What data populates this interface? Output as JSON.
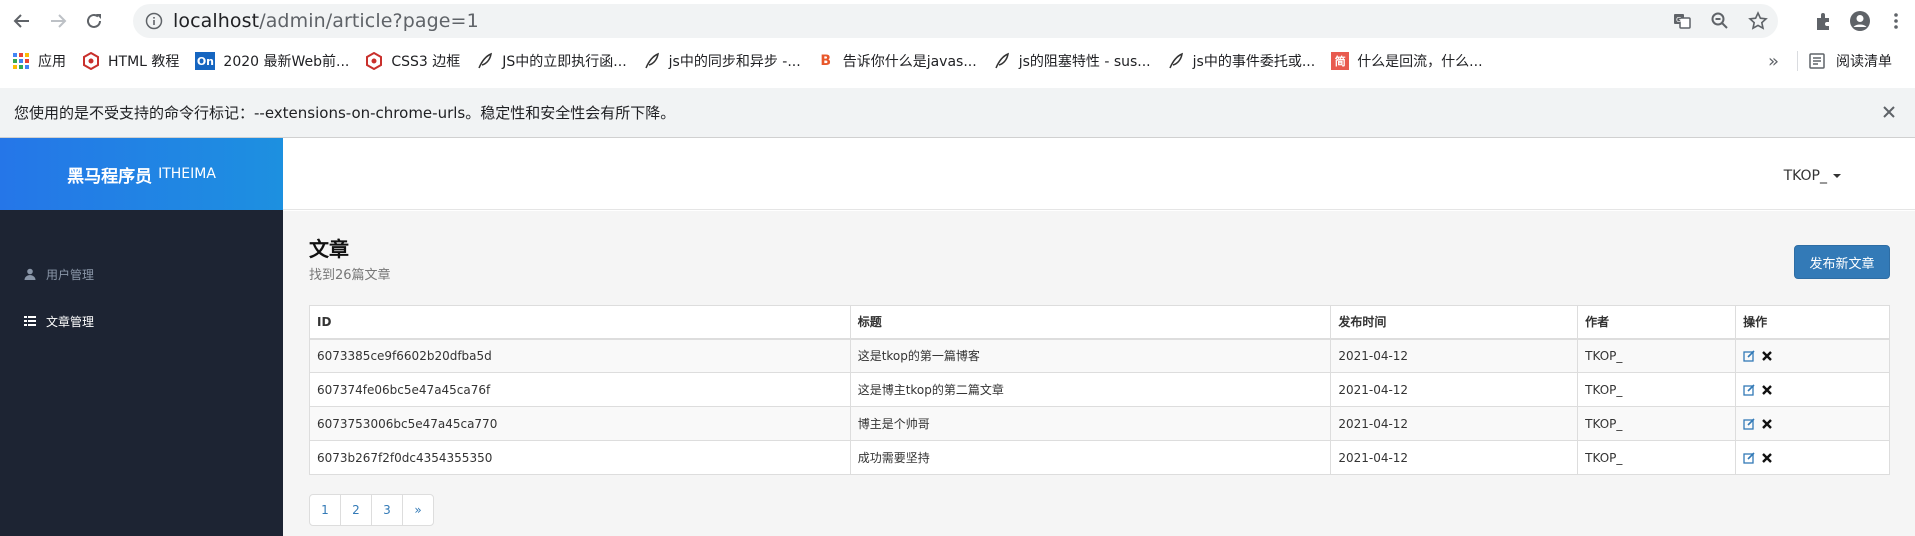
{
  "browser": {
    "url_host": "localhost",
    "url_path": "/admin/article?page=1",
    "bookmarks": [
      {
        "label": "应用",
        "icon": "apps-grid-icon"
      },
      {
        "label": "HTML 教程",
        "icon": "runoob-icon"
      },
      {
        "label": "2020 最新Web前...",
        "icon": "on-badge-icon"
      },
      {
        "label": "CSS3 边框",
        "icon": "runoob-icon"
      },
      {
        "label": "JS中的立即执行函...",
        "icon": "feather-icon"
      },
      {
        "label": "js中的同步和异步 -...",
        "icon": "feather-icon"
      },
      {
        "label": "告诉你什么是javas...",
        "icon": "b-logo-icon"
      },
      {
        "label": "js的阻塞特性 - sus...",
        "icon": "feather-icon"
      },
      {
        "label": "js中的事件委托或...",
        "icon": "feather-icon"
      },
      {
        "label": "什么是回流，什么...",
        "icon": "jian-icon"
      }
    ],
    "bookmarks_more": "»",
    "reading_list": "阅读清单",
    "infobar_message": "您使用的是不受支持的命令行标记：--extensions-on-chrome-urls。稳定性和安全性会有所下降。"
  },
  "app": {
    "brand": {
      "name": "黑马程序员",
      "sub": "ITHEIMA"
    },
    "user": "TKOP_",
    "menu": [
      {
        "label": "用户管理",
        "icon": "user-icon",
        "active": false
      },
      {
        "label": "文章管理",
        "icon": "list-icon",
        "active": true
      }
    ],
    "page_title": "文章",
    "page_subtitle": "找到26篇文章",
    "publish_button": "发布新文章",
    "table": {
      "headers": [
        "ID",
        "标题",
        "发布时间",
        "作者",
        "操作"
      ],
      "rows": [
        [
          "6073385ce9f6602b20dfba5d",
          "这是tkop的第一篇博客",
          "2021-04-12",
          "TKOP_"
        ],
        [
          "607374fe06bc5e47a45ca76f",
          "这是博主tkop的第二篇文章",
          "2021-04-12",
          "TKOP_"
        ],
        [
          "6073753006bc5e47a45ca770",
          "博主是个帅哥",
          "2021-04-12",
          "TKOP_"
        ],
        [
          "6073b267f2f0dc4354355350",
          "成功需要坚持",
          "2021-04-12",
          "TKOP_"
        ]
      ]
    },
    "pagination": [
      "1",
      "2",
      "3",
      "»"
    ]
  }
}
